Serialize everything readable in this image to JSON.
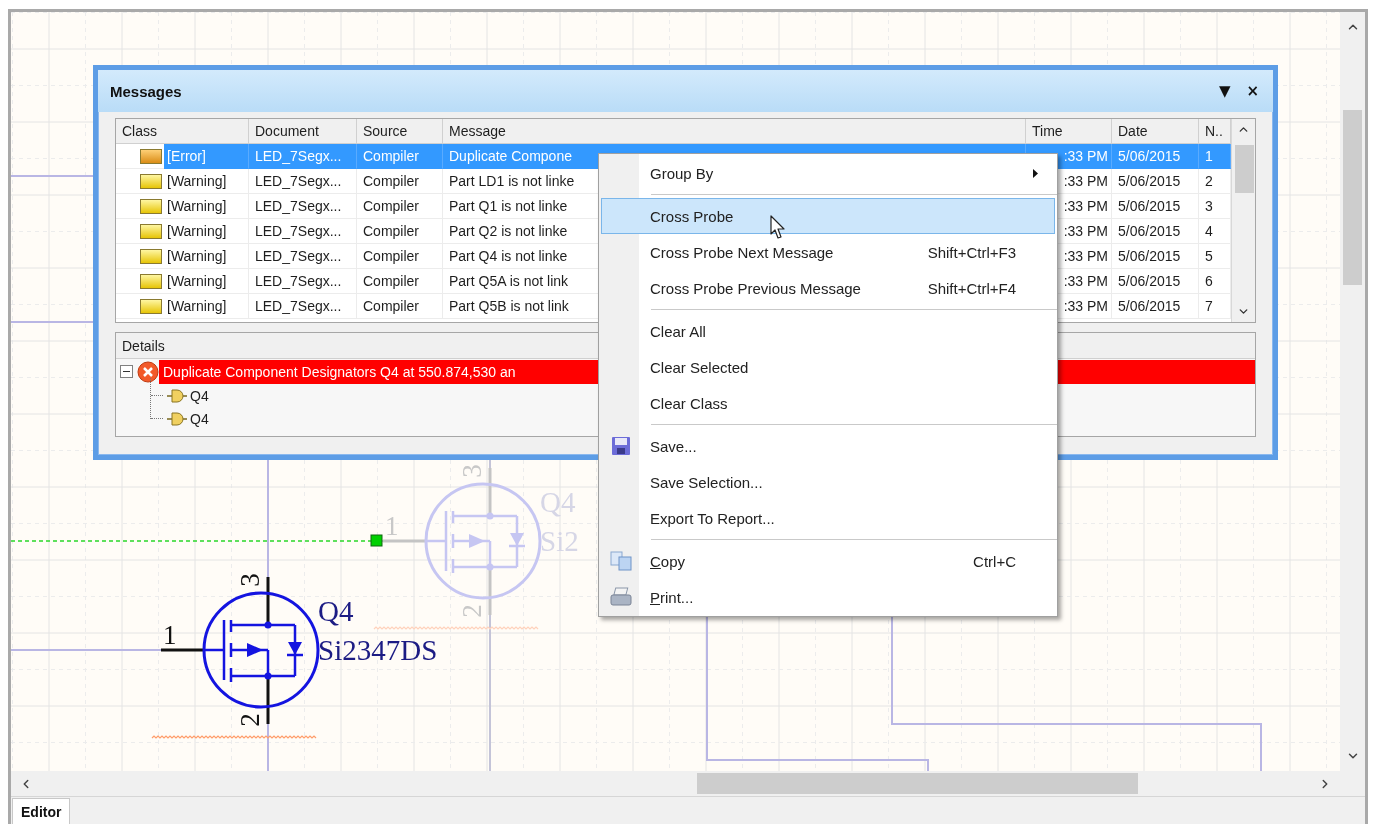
{
  "messages_panel": {
    "title": "Messages",
    "menu_glyph": "▼",
    "close_glyph": "×",
    "columns": [
      "Class",
      "Document",
      "Source",
      "Message",
      "Time",
      "Date",
      "N.."
    ],
    "rows": [
      {
        "kind": "error",
        "class": "[Error]",
        "document": "LED_7Segx...",
        "source": "Compiler",
        "message": "Duplicate Compone",
        "time": ":33 PM",
        "date": "5/06/2015",
        "number": "1",
        "selected": true
      },
      {
        "kind": "warning",
        "class": "[Warning]",
        "document": "LED_7Segx...",
        "source": "Compiler",
        "message": "Part LD1 is not linke",
        "time": ":33 PM",
        "date": "5/06/2015",
        "number": "2",
        "selected": false
      },
      {
        "kind": "warning",
        "class": "[Warning]",
        "document": "LED_7Segx...",
        "source": "Compiler",
        "message": "Part Q1 is not linke",
        "time": ":33 PM",
        "date": "5/06/2015",
        "number": "3",
        "selected": false
      },
      {
        "kind": "warning",
        "class": "[Warning]",
        "document": "LED_7Segx...",
        "source": "Compiler",
        "message": "Part Q2 is not linke",
        "time": ":33 PM",
        "date": "5/06/2015",
        "number": "4",
        "selected": false
      },
      {
        "kind": "warning",
        "class": "[Warning]",
        "document": "LED_7Segx...",
        "source": "Compiler",
        "message": "Part Q4 is not linke",
        "time": ":33 PM",
        "date": "5/06/2015",
        "number": "5",
        "selected": false
      },
      {
        "kind": "warning",
        "class": "[Warning]",
        "document": "LED_7Segx...",
        "source": "Compiler",
        "message": "Part Q5A is not link",
        "time": ":33 PM",
        "date": "5/06/2015",
        "number": "6",
        "selected": false
      },
      {
        "kind": "warning",
        "class": "[Warning]",
        "document": "LED_7Segx...",
        "source": "Compiler",
        "message": "Part Q5B is not link",
        "time": ":33 PM",
        "date": "5/06/2015",
        "number": "7",
        "selected": false
      }
    ],
    "details": {
      "title": "Details",
      "message": {
        "text": "Duplicate Component Designators Q4 at 550.874,530 an",
        "expanded": true,
        "children": [
          {
            "text": "Q4"
          },
          {
            "text": "Q4"
          }
        ]
      }
    }
  },
  "context_menu": {
    "items": [
      {
        "kind": "submenu",
        "label": "Group By",
        "selected": false,
        "mnemonic": false
      },
      {
        "kind": "separator"
      },
      {
        "kind": "plain",
        "label": "Cross Probe",
        "selected": true,
        "mnemonic": false
      },
      {
        "kind": "plain",
        "label": "Cross Probe Next Message",
        "shortcut": "Shift+Ctrl+F3",
        "selected": false,
        "mnemonic": false
      },
      {
        "kind": "plain",
        "label": "Cross Probe Previous Message",
        "shortcut": "Shift+Ctrl+F4",
        "selected": false,
        "mnemonic": false
      },
      {
        "kind": "separator"
      },
      {
        "kind": "plain",
        "label": "Clear All",
        "selected": false,
        "mnemonic": false
      },
      {
        "kind": "plain",
        "label": "Clear Selected",
        "selected": false,
        "mnemonic": false
      },
      {
        "kind": "plain",
        "label": "Clear Class",
        "selected": false,
        "mnemonic": false
      },
      {
        "kind": "separator"
      },
      {
        "kind": "save",
        "label": "Save...",
        "selected": false,
        "mnemonic": false
      },
      {
        "kind": "plain",
        "label": "Save Selection...",
        "selected": false,
        "mnemonic": false
      },
      {
        "kind": "plain",
        "label": "Export To Report...",
        "selected": false,
        "mnemonic": false
      },
      {
        "kind": "separator"
      },
      {
        "kind": "copy",
        "label": "Copy",
        "shortcut": "Ctrl+C",
        "selected": false,
        "mnemonic": true
      },
      {
        "kind": "print",
        "label": "Print...",
        "selected": false,
        "mnemonic": true
      }
    ]
  },
  "schematic": {
    "parts": [
      {
        "kind": "placed",
        "designator": "Q4",
        "value": "Si2347DS",
        "pins": [
          "1",
          "3",
          "2"
        ]
      },
      {
        "kind": "ghost",
        "designator": "Q4",
        "value": "Si2",
        "pins": [
          "1",
          "3",
          "2"
        ]
      }
    ]
  },
  "tabs": [
    {
      "label": "Editor",
      "selected": true
    }
  ]
}
